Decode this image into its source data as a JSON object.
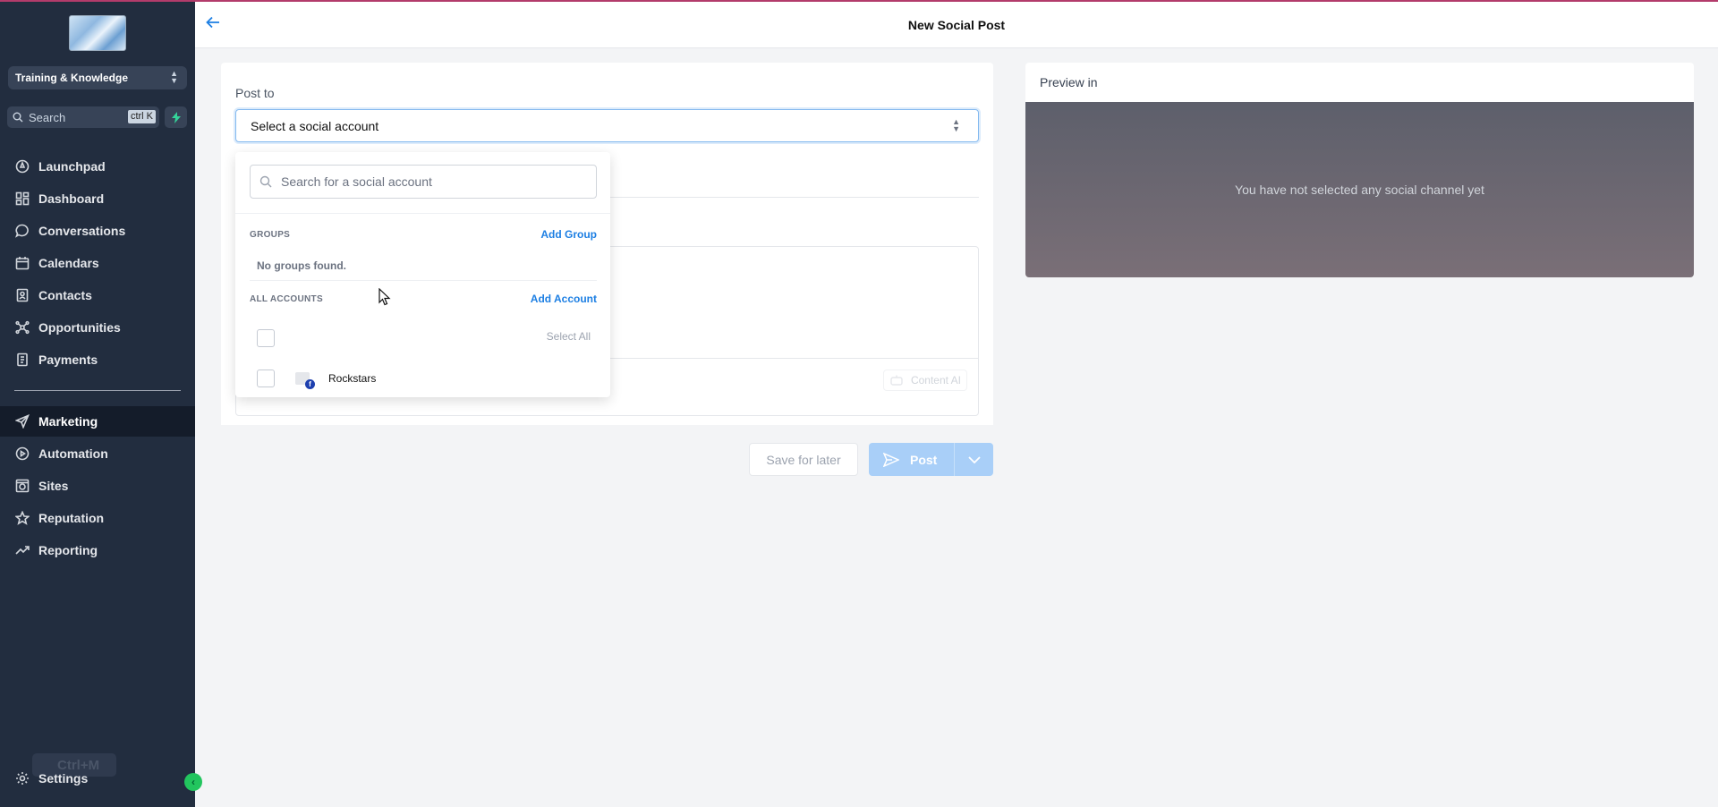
{
  "sidebar": {
    "location": "Training & Knowledge",
    "search_placeholder": "Search",
    "search_shortcut": "ctrl K",
    "items": [
      {
        "label": "Launchpad"
      },
      {
        "label": "Dashboard"
      },
      {
        "label": "Conversations"
      },
      {
        "label": "Calendars"
      },
      {
        "label": "Contacts"
      },
      {
        "label": "Opportunities"
      },
      {
        "label": "Payments"
      },
      {
        "label": "Marketing",
        "active": true
      },
      {
        "label": "Automation"
      },
      {
        "label": "Sites"
      },
      {
        "label": "Reputation"
      },
      {
        "label": "Reporting"
      }
    ],
    "shortcut_hint": "Ctrl+M",
    "settings_label": "Settings"
  },
  "header": {
    "title": "New Social Post"
  },
  "composer": {
    "post_to_label": "Post to",
    "select_placeholder": "Select a social account",
    "content_ai_label": "Content AI",
    "save_later_label": "Save for later",
    "post_label": "Post"
  },
  "dropdown": {
    "search_placeholder": "Search for a social account",
    "groups_title": "GROUPS",
    "add_group_label": "Add Group",
    "no_groups_text": "No groups found.",
    "accounts_title": "ALL ACCOUNTS",
    "add_account_label": "Add Account",
    "select_all_label": "Select All",
    "accounts": [
      {
        "name": "Rockstars",
        "network": "facebook"
      }
    ]
  },
  "preview": {
    "label": "Preview in",
    "empty_text": "You have not selected any social channel yet"
  },
  "colors": {
    "sidebar_bg": "#222d3f",
    "accent": "#1d7fe3",
    "post_button": "#a9cff8",
    "top_line": "#b33b6b"
  }
}
